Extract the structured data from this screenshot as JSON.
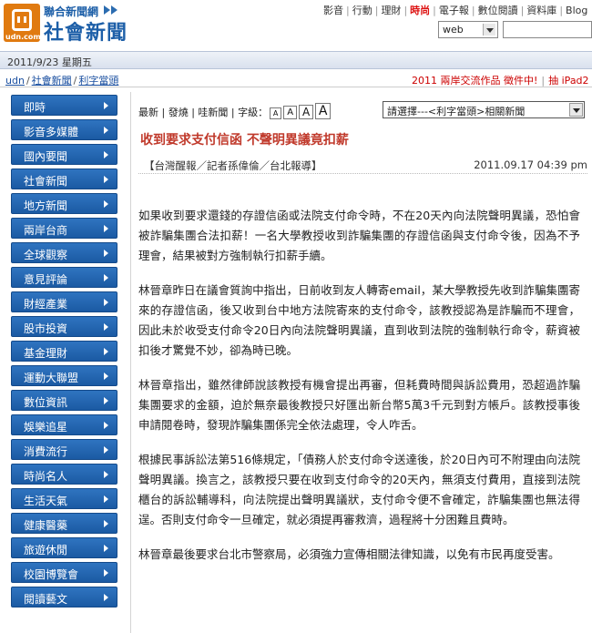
{
  "header": {
    "brand_top": "聯合新聞網",
    "brand_main": "社會新聞",
    "logo_text": "udn.com",
    "logo_icon": "power-plug-icon",
    "nav": [
      "影音",
      "行動",
      "理財",
      "時尚",
      "電子報",
      "數位閱讀",
      "資料庫",
      "Blog"
    ],
    "hot_item": "時尚",
    "search_scope": "web",
    "search_value": ""
  },
  "datebar": {
    "date": "2011/9/23 星期五"
  },
  "breadcrumb": {
    "items": [
      "udn",
      "社會新聞",
      "利字當頭"
    ],
    "separator": "/"
  },
  "promo": {
    "text": "2011 兩岸交流作品 徵件中!",
    "extra": "抽 iPad2"
  },
  "sidebar": {
    "items": [
      "即時",
      "影音多媒體",
      "國內要聞",
      "社會新聞",
      "地方新聞",
      "兩岸台商",
      "全球觀察",
      "意見評論",
      "財經產業",
      "股市投資",
      "基金理財",
      "運動大聯盟",
      "數位資訊",
      "娛樂追星",
      "消費流行",
      "時尚名人",
      "生活天氣",
      "健康醫藥",
      "旅遊休閒",
      "校園博覽會",
      "閱讀藝文"
    ]
  },
  "toolbar": {
    "links": [
      "最新",
      "發燒",
      "哇新聞"
    ],
    "font_label": "字級：",
    "font_sizes": [
      "A",
      "A",
      "A",
      "A"
    ],
    "related_select": "請選擇---<利字當頭>相關新聞"
  },
  "article": {
    "headline": "收到要求支付信函 不聲明異議竟扣薪",
    "byline": "【台灣醒報／記者孫偉倫／台北報導】",
    "timestamp": "2011.09.17 04:39 pm",
    "paragraphs": [
      "如果收到要求還錢的存證信函或法院支付命令時，不在20天內向法院聲明異議，恐怕會被詐騙集團合法扣薪！一名大學教授收到詐騙集團的存證信函與支付命令後，因為不予理會，結果被對方強制執行扣薪手續。",
      "林晉章昨日在議會質詢中指出，日前收到友人轉寄email，某大學教授先收到詐騙集團寄來的存證信函，後又收到台中地方法院寄來的支付命令，該教授認為是詐騙而不理會，因此未於收受支付命令20日內向法院聲明異議，直到收到法院的強制執行命令，薪資被扣後才驚覺不妙，卻為時已晚。",
      "林晉章指出，雖然律師說該教授有機會提出再審，但耗費時間與訴訟費用，恐超過詐騙集團要求的金額，迫於無奈最後教授只好匯出新台幣5萬3千元到對方帳戶。該教授事後申請閱卷時，發現詐騙集團係完全依法處理，令人咋舌。",
      "根據民事訴訟法第516條規定，「債務人於支付命令送達後，於20日內可不附理由向法院聲明異議。換言之，該教授只要在收到支付命令的20天內，無須支付費用，直接到法院櫃台的訴訟輔導科，向法院提出聲明異議狀，支付命令便不會確定，詐騙集團也無法得逞。否則支付命令一旦確定，就必須提再審救濟，過程將十分困難且費時。",
      "林晉章最後要求台北市警察局，必須強力宣傳相關法律知識，以免有市民再度受害。"
    ]
  },
  "colors": {
    "brand_blue": "#1d5fa8",
    "logo_orange": "#e07a10",
    "headline_red": "#c0392b",
    "nav_blue": "#1b5aa3"
  }
}
